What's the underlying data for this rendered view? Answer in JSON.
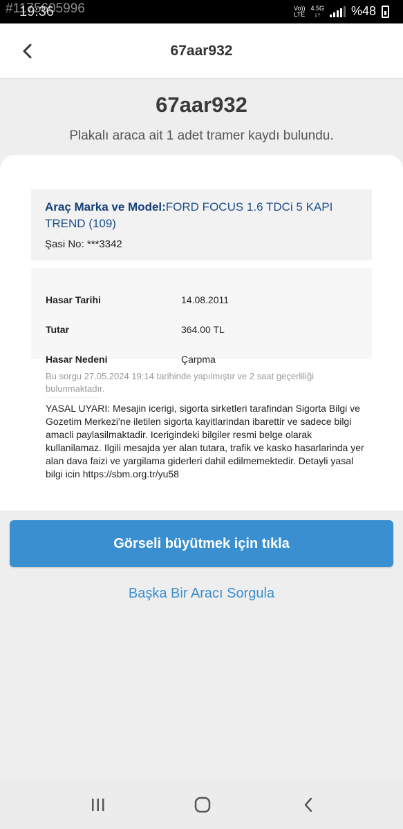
{
  "status_bar": {
    "time": "19:36",
    "watermark_id": "#1175605996",
    "network_top": "Vo))",
    "network_bottom": "LTE",
    "network_type": "4.5G",
    "battery_text": "%48"
  },
  "app_bar": {
    "title": "67aar932",
    "back_icon": "chevron-left-icon"
  },
  "header": {
    "plate": "67aar932",
    "subtitle": "Plakalı araca ait 1 adet tramer kaydı bulundu."
  },
  "vehicle": {
    "brand_label": "Araç Marka ve Model:",
    "brand_value": "FORD FOCUS 1.6 TDCi 5 KAPI TREND (109)",
    "chassis_label": "Şasi No:",
    "chassis_value": "***3342"
  },
  "damage": {
    "rows": [
      {
        "label": "Hasar Tarihi",
        "value": "14.08.2011"
      },
      {
        "label": "Tutar",
        "value": "364.00 TL"
      },
      {
        "label": "Hasar Nedeni",
        "value": "Çarpma"
      }
    ]
  },
  "notes": {
    "query_note": "Bu sorgu 27.05.2024 19:14 tarihinde yapılmıştır ve 2 saat geçerliliği bulunmaktadır.",
    "legal": "YASAL UYARI: Mesajin icerigi, sigorta sirketleri tarafindan Sigorta Bilgi ve Gozetim Merkezi'ne iletilen sigorta kayitlarindan ibarettir ve sadece bilgi amacli paylasilmaktadir. Icerigindeki bilgiler resmi belge olarak kullanilamaz. Ilgili mesajda yer alan tutara, trafik ve kasko hasarlarinda yer alan dava faizi ve yargilama giderleri dahil edilmemektedir. Detayli yasal bilgi icin https://sbm.org.tr/yu58"
  },
  "actions": {
    "enlarge": "Görseli büyütmek için tıkla",
    "other_vehicle": "Başka Bir Aracı Sorgula"
  },
  "colors": {
    "accent": "#3a8fd0",
    "brand_text": "#1d4f8c",
    "background": "#eeeeee"
  }
}
